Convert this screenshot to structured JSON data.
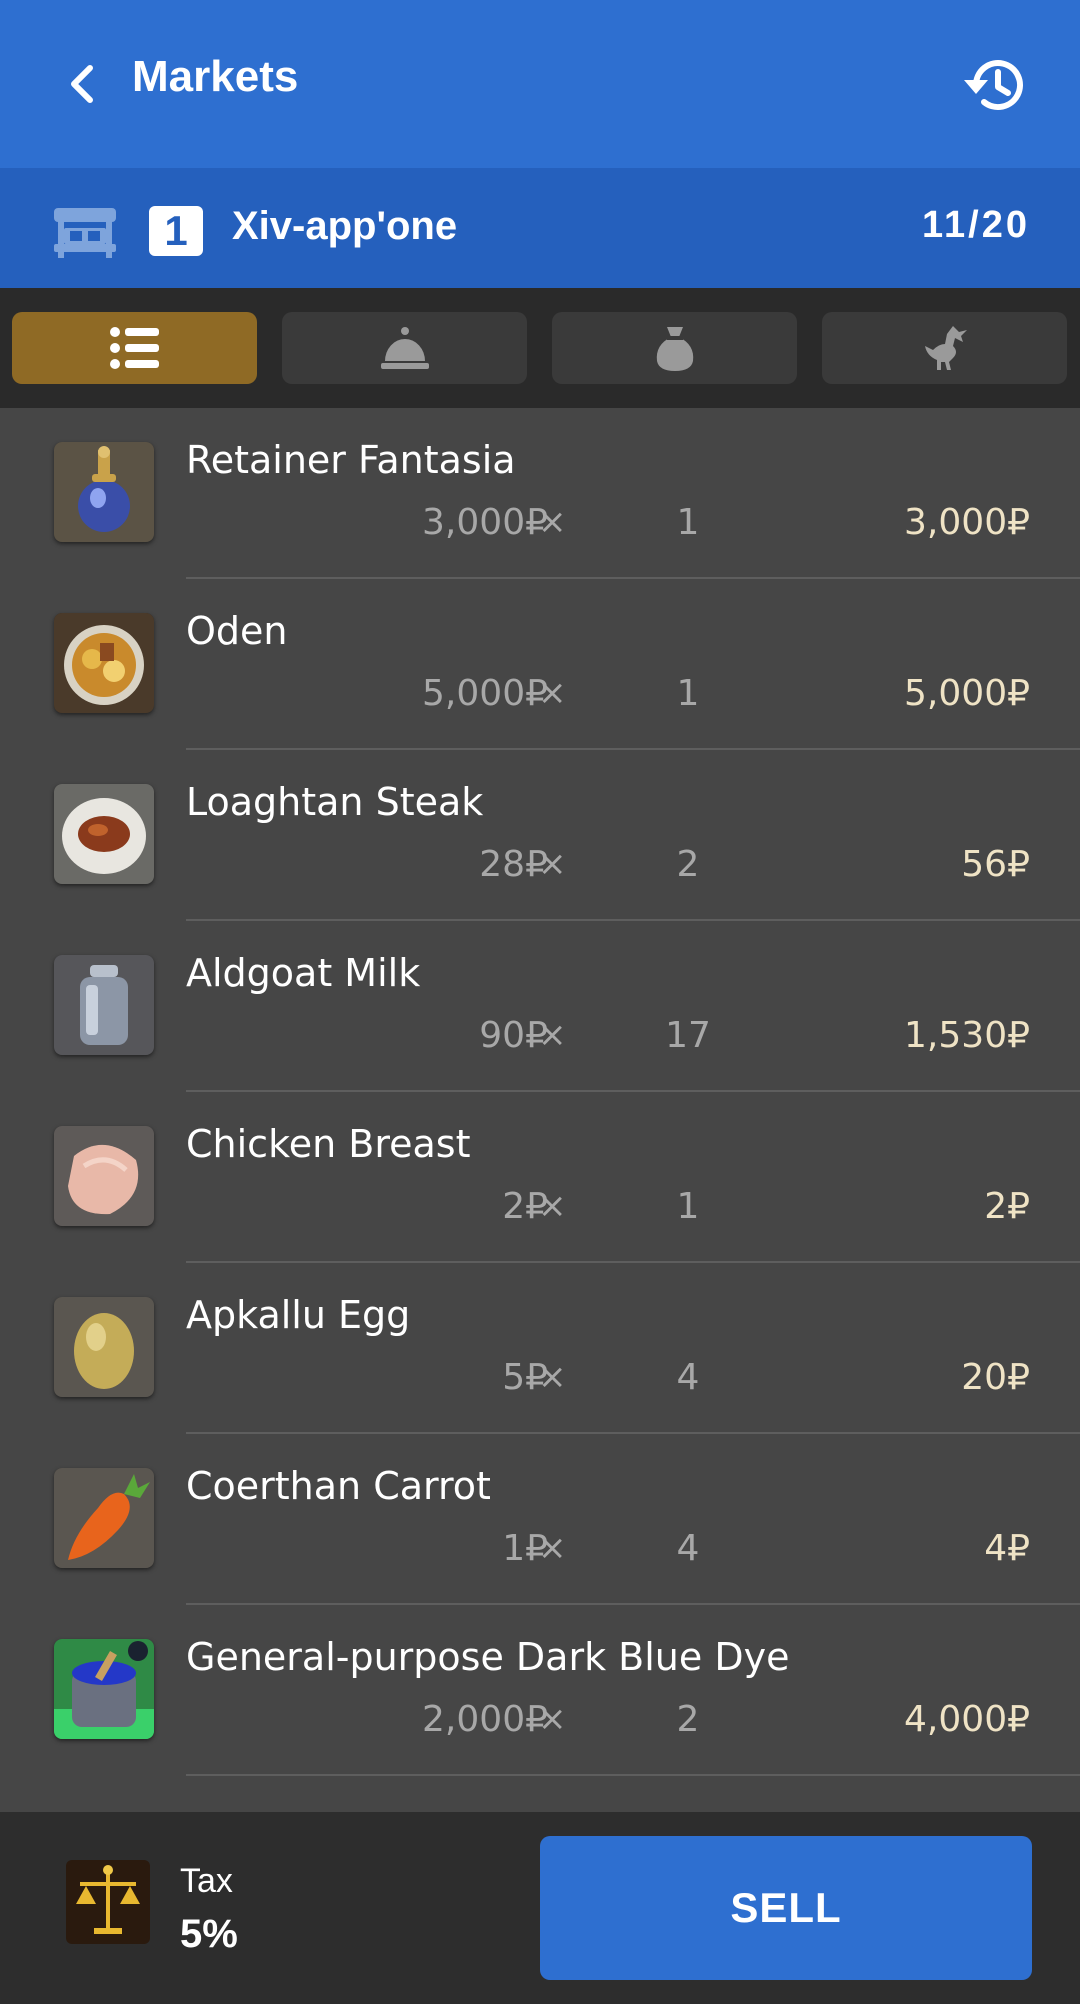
{
  "header": {
    "title": "Markets",
    "back_icon": "chevron-left-icon",
    "history_icon": "history-icon"
  },
  "retainer": {
    "number": "1",
    "name": "Xiv-app'one",
    "count": "11/20"
  },
  "tabs": [
    {
      "icon": "list-icon",
      "active": true
    },
    {
      "icon": "service-bell-icon",
      "active": false
    },
    {
      "icon": "sack-icon",
      "active": false
    },
    {
      "icon": "chocobo-icon",
      "active": false
    }
  ],
  "items": [
    {
      "name": "Retainer Fantasia",
      "unit_price": "3,000₽",
      "times": "×",
      "qty": "1",
      "total": "3,000₽",
      "icon": "potion-icon"
    },
    {
      "name": "Oden",
      "unit_price": "5,000₽",
      "times": "×",
      "qty": "1",
      "total": "5,000₽",
      "icon": "oden-icon"
    },
    {
      "name": "Loaghtan Steak",
      "unit_price": "28₽",
      "times": "×",
      "qty": "2",
      "total": "56₽",
      "icon": "steak-icon"
    },
    {
      "name": "Aldgoat Milk",
      "unit_price": "90₽",
      "times": "×",
      "qty": "17",
      "total": "1,530₽",
      "icon": "milk-can-icon"
    },
    {
      "name": "Chicken Breast",
      "unit_price": "2₽",
      "times": "×",
      "qty": "1",
      "total": "2₽",
      "icon": "chicken-breast-icon"
    },
    {
      "name": "Apkallu Egg",
      "unit_price": "5₽",
      "times": "×",
      "qty": "4",
      "total": "20₽",
      "icon": "egg-icon"
    },
    {
      "name": "Coerthan Carrot",
      "unit_price": "1₽",
      "times": "×",
      "qty": "4",
      "total": "4₽",
      "icon": "carrot-icon"
    },
    {
      "name": "General-purpose Dark Blue Dye",
      "unit_price": "2,000₽",
      "times": "×",
      "qty": "2",
      "total": "4,000₽",
      "icon": "dye-pot-icon"
    }
  ],
  "footer": {
    "tax_label": "Tax",
    "tax_value": "5%",
    "sell_label": "SELL",
    "tax_icon": "scales-emblem-icon"
  },
  "colors": {
    "header": "#2e6fd0",
    "retainer_bar": "#2560bd",
    "active_tab": "#8f6a25",
    "list_bg": "#464646",
    "total_text": "#efe3c5"
  }
}
